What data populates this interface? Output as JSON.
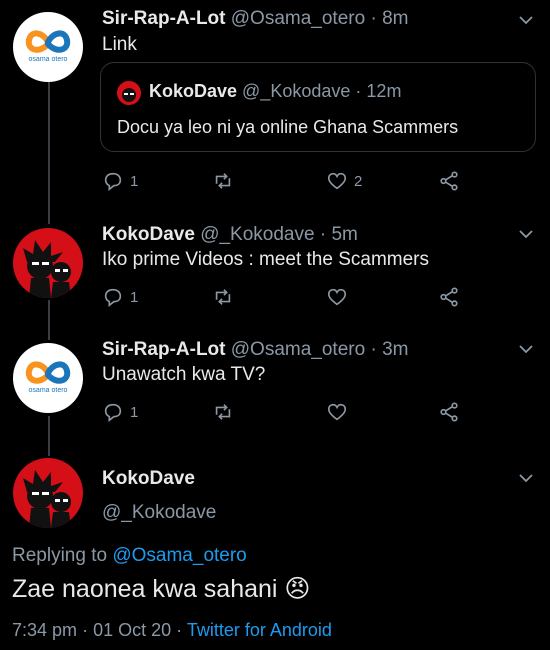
{
  "tweets": [
    {
      "name": "Sir-Rap-A-Lot",
      "handle": "@Osama_otero",
      "time": "8m",
      "text": "Link",
      "avatar_text": "osama otero",
      "quote": {
        "name": "KokoDave",
        "handle": "@_Kokodave",
        "time": "12m",
        "text": "Docu ya leo ni ya online Ghana Scammers"
      },
      "replies": "1",
      "likes": "2"
    },
    {
      "name": "KokoDave",
      "handle": "@_Kokodave",
      "time": "5m",
      "text": "Iko prime Videos : meet the Scammers",
      "replies": "1",
      "likes": ""
    },
    {
      "name": "Sir-Rap-A-Lot",
      "handle": "@Osama_otero",
      "time": "3m",
      "text": "Unawatch kwa TV?",
      "avatar_text": "osama otero",
      "replies": "1",
      "likes": ""
    }
  ],
  "main": {
    "name": "KokoDave",
    "handle": "@_Kokodave",
    "replying_prefix": "Replying to",
    "replying_handle": "@Osama_otero",
    "text": "Zae naonea kwa sahani",
    "emoji": "😠",
    "time": "7:34 pm",
    "date": "01 Oct 20",
    "source": "Twitter for Android"
  },
  "colors": {
    "background": "#000000",
    "link": "#1d9bf0",
    "muted": "#8b98a5",
    "avatar_red": "#d40f17",
    "brand_orange": "#f7931e",
    "brand_blue": "#1b75bb"
  }
}
